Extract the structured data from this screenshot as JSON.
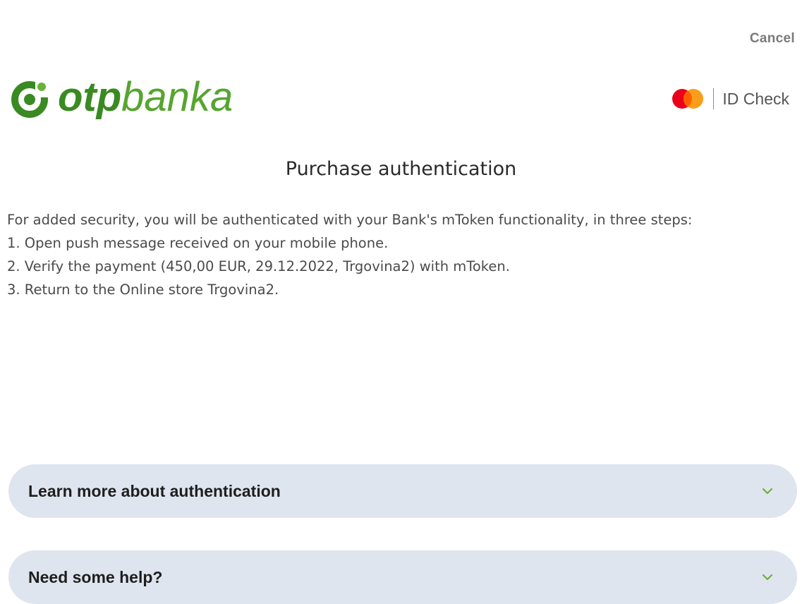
{
  "header": {
    "cancel_label": "Cancel",
    "logo": {
      "text_bold": "otp",
      "text_regular": "banka",
      "icon": "otp-logo-mark"
    },
    "id_check": {
      "icon": "mastercard-logo",
      "label": "ID Check"
    }
  },
  "main": {
    "title": "Purchase authentication",
    "intro": "For added security, you will be authenticated with your Bank's mToken functionality, in three steps:",
    "steps": [
      "1. Open push message received on your mobile phone.",
      "2. Verify the payment (450,00 EUR, 29.12.2022, Trgovina2) with mToken.",
      "3. Return to the Online store Trgovina2."
    ]
  },
  "accordions": [
    {
      "label": "Learn more about authentication",
      "icon": "chevron-down-icon"
    },
    {
      "label": "Need some help?",
      "icon": "chevron-down-icon"
    }
  ],
  "colors": {
    "brand_green": "#4f9a2a",
    "accordion_bg": "#dfe5ee",
    "chevron": "#6bb13a",
    "mastercard_red": "#eb001b",
    "mastercard_orange": "#f79e1b"
  }
}
